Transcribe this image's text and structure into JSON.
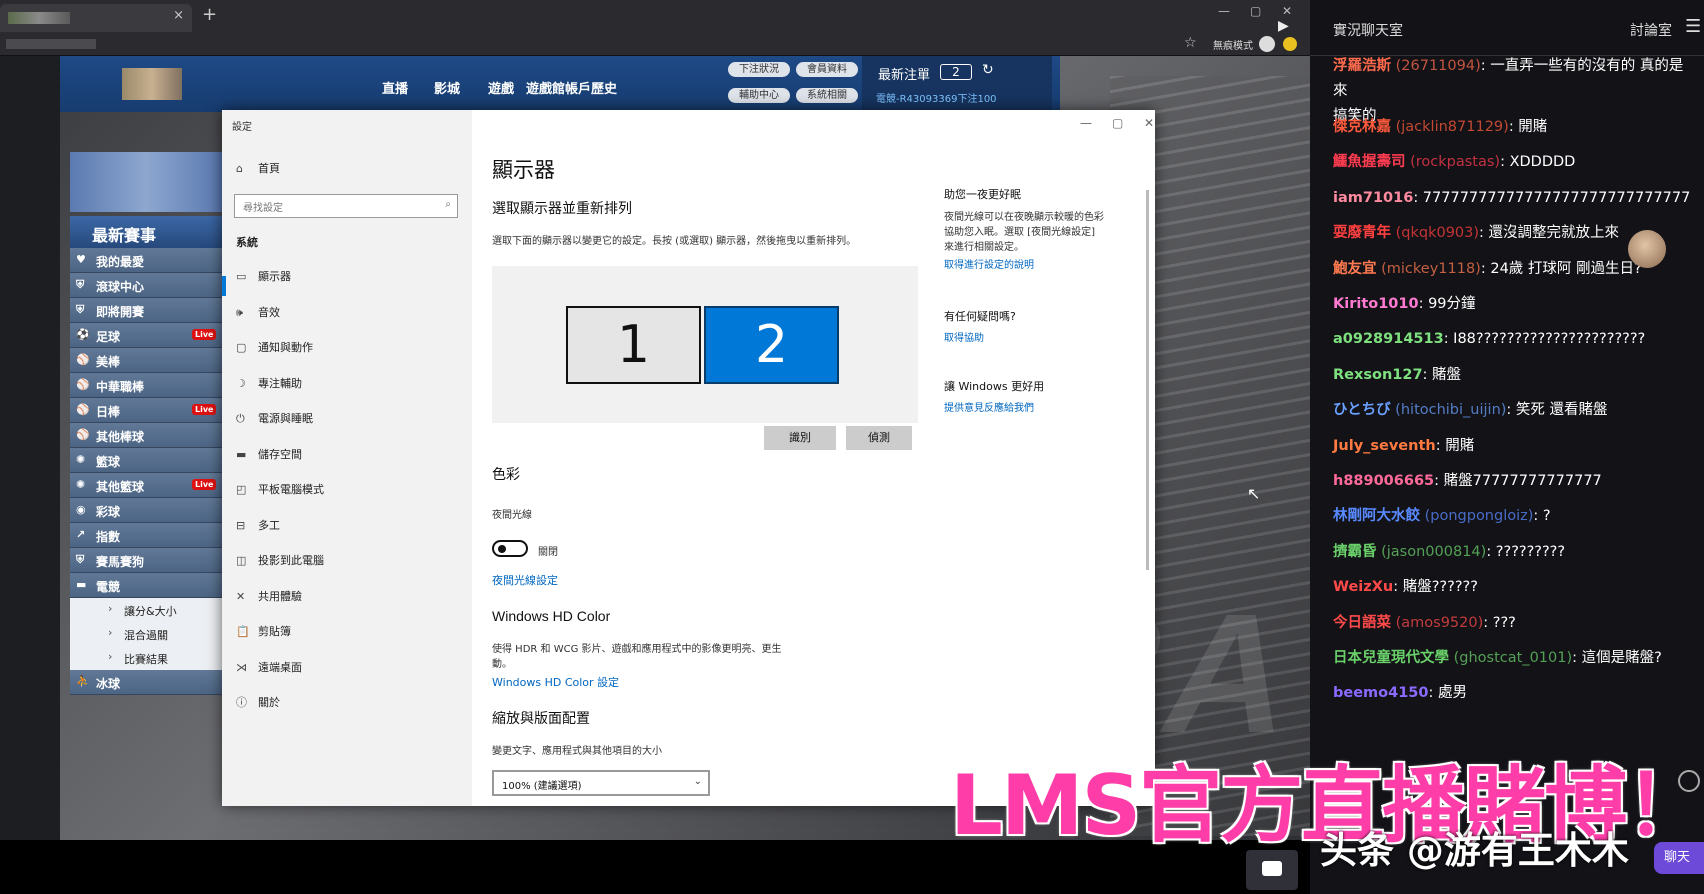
{
  "browser": {
    "close": "×",
    "new_tab": "+",
    "incognito_label": "無痕模式"
  },
  "site": {
    "nav": [
      "直播",
      "影城",
      "遊戲",
      "遊戲館帳戶歷史"
    ],
    "pills": [
      "下注狀況",
      "會員資料",
      "輔助中心",
      "系統相關"
    ],
    "bet_panel_title": "最新注單",
    "bet_count": "2",
    "bet_line": "電競-R43093369下注100",
    "menu_title": "最新賽事",
    "menu_items": [
      {
        "icon": "heart-icon",
        "glyph": "♥",
        "label": "我的最愛",
        "live": ""
      },
      {
        "icon": "shield-icon",
        "glyph": "⛨",
        "label": "滾球中心",
        "live": ""
      },
      {
        "icon": "shield-icon",
        "glyph": "⛨",
        "label": "即將開賽",
        "live": ""
      },
      {
        "icon": "soccer-icon",
        "glyph": "⚽",
        "label": "足球",
        "live": "Live"
      },
      {
        "icon": "baseball-icon",
        "glyph": "⚾",
        "label": "美棒",
        "live": ""
      },
      {
        "icon": "baseball-icon",
        "glyph": "⚾",
        "label": "中華職棒",
        "live": ""
      },
      {
        "icon": "baseball-icon",
        "glyph": "⚾",
        "label": "日棒",
        "live": "Live"
      },
      {
        "icon": "baseball-icon",
        "glyph": "⚾",
        "label": "其他棒球",
        "live": ""
      },
      {
        "icon": "basketball-icon",
        "glyph": "✺",
        "label": "籃球",
        "live": ""
      },
      {
        "icon": "basketball-icon",
        "glyph": "✺",
        "label": "其他籃球",
        "live": "Live"
      },
      {
        "icon": "lottery-icon",
        "glyph": "◉",
        "label": "彩球",
        "live": ""
      },
      {
        "icon": "chart-icon",
        "glyph": "↗",
        "label": "指數",
        "live": ""
      },
      {
        "icon": "shield-icon",
        "glyph": "⛨",
        "label": "賽馬賽狗",
        "live": ""
      },
      {
        "icon": "esports-icon",
        "glyph": "▬",
        "label": "電競",
        "live": ""
      }
    ],
    "sub_items": [
      "讓分&大小",
      "混合過關",
      "比賽結果"
    ],
    "last_item": {
      "icon": "hockey-icon",
      "glyph": "⛹",
      "label": "冰球"
    }
  },
  "settings": {
    "window_title": "設定",
    "home": "首頁",
    "search_placeholder": "尋找設定",
    "category": "系統",
    "nav": [
      {
        "icon": "display-icon",
        "glyph": "▭",
        "label": "顯示器"
      },
      {
        "icon": "sound-icon",
        "glyph": "🕪",
        "label": "音效"
      },
      {
        "icon": "notification-icon",
        "glyph": "▢",
        "label": "通知與動作"
      },
      {
        "icon": "focus-assist-icon",
        "glyph": "☽",
        "label": "專注輔助"
      },
      {
        "icon": "power-icon",
        "glyph": "⏻",
        "label": "電源與睡眠"
      },
      {
        "icon": "storage-icon",
        "glyph": "▬",
        "label": "儲存空間"
      },
      {
        "icon": "tablet-icon",
        "glyph": "◰",
        "label": "平板電腦模式"
      },
      {
        "icon": "multitasking-icon",
        "glyph": "⊟",
        "label": "多工"
      },
      {
        "icon": "project-icon",
        "glyph": "◫",
        "label": "投影到此電腦"
      },
      {
        "icon": "shared-icon",
        "glyph": "✕",
        "label": "共用體驗"
      },
      {
        "icon": "clipboard-icon",
        "glyph": "📋",
        "label": "剪貼簿"
      },
      {
        "icon": "remote-desktop-icon",
        "glyph": "⋊",
        "label": "遠端桌面"
      },
      {
        "icon": "about-icon",
        "glyph": "ⓘ",
        "label": "關於"
      }
    ],
    "main": {
      "title": "顯示器",
      "arrange_heading": "選取顯示器並重新排列",
      "arrange_desc": "選取下面的顯示器以變更它的設定。長按 (或選取) 顯示器，然後拖曳以重新排列。",
      "monitor1": "1",
      "monitor2": "2",
      "identify": "識別",
      "detect": "偵測",
      "color_heading": "色彩",
      "night_light": "夜間光線",
      "night_light_state": "關閉",
      "night_light_settings": "夜間光線設定",
      "hd_heading": "Windows HD Color",
      "hd_desc_1": "使得 HDR 和 WCG 影片、遊戲和應用程式中的影像更明亮、更生",
      "hd_desc_2": "動。",
      "hd_link": "Windows HD Color 設定",
      "scale_heading": "縮放與版面配置",
      "scale_label": "變更文字、應用程式與其他項目的大小",
      "scale_value": "100% (建議選項)"
    },
    "right": {
      "sleep_title": "助您一夜更好眠",
      "sleep_desc_1": "夜間光線可以在夜晚顯示較暖的色彩",
      "sleep_desc_2": "協助您入眠。選取 [夜間光線設定]",
      "sleep_desc_3": "來進行相關設定。",
      "sleep_link": "取得進行設定的說明",
      "q_title": "有任何疑問嗎?",
      "q_link": "取得協助",
      "improve_title": "讓 Windows 更好用",
      "improve_link": "提供意見反應給我們"
    }
  },
  "chat": {
    "title": "實況聊天室",
    "tab": "討論室",
    "messages": [
      {
        "user": "浮羅浩斯",
        "id": " (26711094)",
        "text": ": 一直弄一些有的沒有的 真的是來",
        "text2": "搞笑的",
        "color": "#ff6a4d"
      },
      {
        "user": "傑克林嘉",
        "id": " (jacklin871129)",
        "text": ": 開賭",
        "color": "#ff5a3c"
      },
      {
        "user": "鱷魚握壽司",
        "id": " (rockpastas)",
        "text": ": XDDDDD",
        "color": "#ff3c50"
      },
      {
        "user": "iam71016",
        "id": "",
        "text": ": 77777777777777777777777777777",
        "color": "#ff8aa0"
      },
      {
        "user": "耍廢青年",
        "id": " (qkqk0903)",
        "text": ": 還沒調整完就放上來",
        "color": "#ff4040"
      },
      {
        "user": "鮑友宜",
        "id": " (mickey1118)",
        "text": ": 24歲 打球阿 剛過生日?",
        "color": "#ff7a50"
      },
      {
        "user": "Kirito1010",
        "id": "",
        "text": ": 99分鐘",
        "color": "#ff7ad0"
      },
      {
        "user": "a0928914513",
        "id": "",
        "text": ": I88??????????????????????",
        "color": "#7ee07e"
      },
      {
        "user": "Rexson127",
        "id": "",
        "text": ": 賭盤",
        "color": "#7ee07e"
      },
      {
        "user": "ひとちび",
        "id": " (hitochibi_uijin)",
        "text": ": 笑死 還看賭盤",
        "color": "#6aa0ff"
      },
      {
        "user": "July_seventh",
        "id": "",
        "text": ": 開賭",
        "color": "#ff7a40"
      },
      {
        "user": "h889006665",
        "id": "",
        "text": ": 賭盤77777777777777",
        "color": "#ff6a9a"
      },
      {
        "user": "林剛阿大水餃",
        "id": " (pongpongloiz)",
        "text": ": ?",
        "color": "#5a8aff"
      },
      {
        "user": "擠霸昏",
        "id": " (jason000814)",
        "text": ": ?????????",
        "color": "#6ad06a"
      },
      {
        "user": "WeizXu",
        "id": "",
        "text": ": 賭盤??????",
        "color": "#ff4a4a"
      },
      {
        "user": "今日語菜",
        "id": " (amos9520)",
        "text": ": ???",
        "color": "#ff4a4a"
      },
      {
        "user": "日本兒童現代文學",
        "id": " (ghostcat_0101)",
        "text": ": 這個是賭盤?",
        "color": "#6ad06a"
      },
      {
        "user": "beemo4150",
        "id": "",
        "text": ": 處男",
        "color": "#8a6aff"
      }
    ],
    "send": "聊天"
  },
  "overlay_text": "LMS官方直播賭博！",
  "watermark": "头条 @游有王木木"
}
